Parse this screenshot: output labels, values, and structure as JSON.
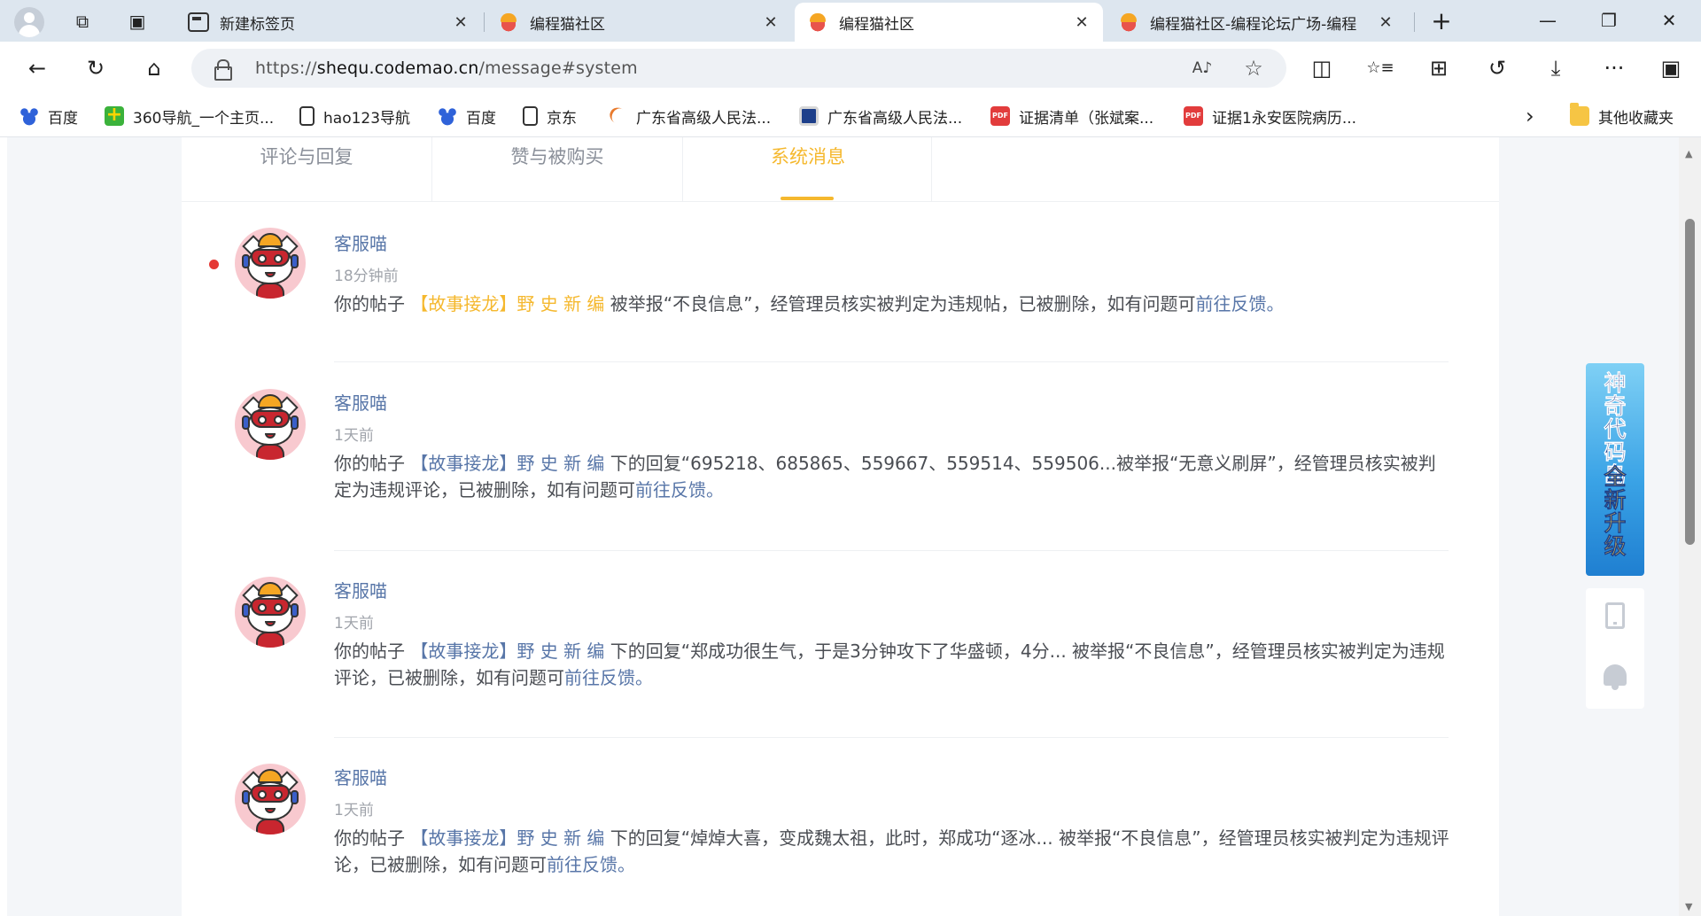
{
  "browser": {
    "tabs": [
      {
        "title": "新建标签页",
        "active": false
      },
      {
        "title": "编程猫社区",
        "active": false
      },
      {
        "title": "编程猫社区",
        "active": true
      },
      {
        "title": "编程猫社区-编程论坛广场-编程",
        "active": false
      }
    ],
    "tab_close": "✕",
    "new_tab": "+",
    "window": {
      "minimize": "—",
      "restore": "❐",
      "close": "✕"
    },
    "url": {
      "prefix": "https://",
      "host": "shequ.codemao.cn",
      "path": "/message#system"
    },
    "nav_icons": {
      "back": "←",
      "reload": "↻",
      "home": "⌂",
      "read_aloud": "A♪",
      "favorite": "☆",
      "split": "◫",
      "favorites": "☆≡",
      "collections": "⊞",
      "history": "↺",
      "downloads": "⤓",
      "more": "···",
      "sidebar": "▣"
    },
    "bookmarks": [
      {
        "label": "百度",
        "icon": "baidu"
      },
      {
        "label": "360导航_一个主页...",
        "icon": "360"
      },
      {
        "label": "hao123导航",
        "icon": "page"
      },
      {
        "label": "百度",
        "icon": "baidu"
      },
      {
        "label": "京东",
        "icon": "page"
      },
      {
        "label": "广东省高级人民法...",
        "icon": "arc"
      },
      {
        "label": "广东省高级人民法...",
        "icon": "court"
      },
      {
        "label": "证据清单（张斌案...",
        "icon": "pdf"
      },
      {
        "label": "证据1永安医院病历...",
        "icon": "pdf"
      }
    ],
    "bookmarks_more": "›",
    "other_bookmarks": "其他收藏夹"
  },
  "content_tabs": [
    {
      "label": "评论与回复",
      "selected": false
    },
    {
      "label": "赞与被购买",
      "selected": false
    },
    {
      "label": "系统消息",
      "selected": true
    }
  ],
  "messages": [
    {
      "sender": "客服喵",
      "time": "18分钟前",
      "unread": true,
      "prefix": "你的帖子 ",
      "post": "【故事接龙】野 史 新 编",
      "post_style": "orange",
      "middle": " 被举报“不良信息”，经管理员核实被判定为违规帖，已被删除，如有问题可",
      "link": "前往反馈",
      "suffix": "。"
    },
    {
      "sender": "客服喵",
      "time": "1天前",
      "unread": false,
      "prefix": "你的帖子 ",
      "post": "【故事接龙】野 史 新 编",
      "post_style": "blue",
      "middle": " 下的回复“695218、685865、559667、559514、559506...被举报“无意义刷屏”，经管理员核实被判定为违规评论，已被删除，如有问题可",
      "link": "前往反馈",
      "suffix": "。"
    },
    {
      "sender": "客服喵",
      "time": "1天前",
      "unread": false,
      "prefix": "你的帖子 ",
      "post": "【故事接龙】野 史 新 编",
      "post_style": "blue",
      "middle": " 下的回复“郑成功很生气，于是3分钟攻下了华盛顿，4分... 被举报“不良信息”，经管理员核实被判定为违规评论，已被删除，如有问题可",
      "link": "前往反馈",
      "suffix": "。"
    },
    {
      "sender": "客服喵",
      "time": "1天前",
      "unread": false,
      "prefix": "你的帖子 ",
      "post": "【故事接龙】野 史 新 编",
      "post_style": "blue",
      "middle": " 下的回复“焯焯大喜，变成魏太祖，此时，郑成功“逐冰...  被举报“不良信息”，经管理员核实被判定为违规评论，已被删除，如有问题可",
      "link": "前往反馈",
      "suffix": "。"
    }
  ],
  "promo": {
    "line1": "神奇代码岛",
    "line2": "全新升级"
  },
  "colors": {
    "accent": "#f5b82e",
    "link": "#5876a8",
    "unread_dot": "#e53935"
  }
}
